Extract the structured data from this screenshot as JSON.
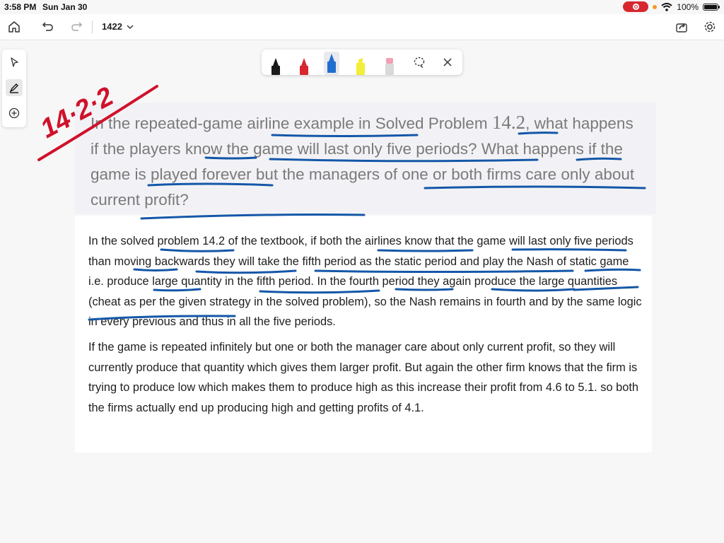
{
  "status_bar": {
    "time": "3:58 PM",
    "date": "Sun Jan 30",
    "battery": "100%"
  },
  "toolbar": {
    "document_title": "1422"
  },
  "icons": {
    "home": "home-icon",
    "undo": "undo-icon",
    "redo": "redo-icon",
    "share": "share-icon",
    "settings": "gear-icon",
    "select": "pointer-arrow-icon",
    "pen": "pen-icon",
    "add": "add-circle-icon",
    "lasso": "lasso-icon",
    "close": "close-icon"
  },
  "colors": {
    "ink_red": "#d0112b",
    "ink_blue": "#1457a8",
    "pen_black": "#1a1a1a",
    "pen_red": "#d8262f",
    "pen_blue": "#1f6fcf",
    "highlighter_yellow": "#f2ee3a",
    "eraser_pink": "#f2a0b4"
  },
  "pen_palette": {
    "tools": [
      "black-pen",
      "red-pen",
      "blue-pen",
      "yellow-highlighter",
      "eraser"
    ],
    "selected": "blue-pen"
  },
  "handwriting": {
    "annotation": "14·2·2"
  },
  "question": {
    "before": "In the repeated-game airline example in Solved Problem ",
    "number": "14.2",
    "after": ", what happens if the players know the game will last only five periods? What happens if the game is played forever but the managers of one or both firms care only about current profit?"
  },
  "answer": {
    "paragraph1": "In the solved problem 14.2 of the textbook, if both the airlines know that the game will last only five periods than moving backwards they will take the fifth period as the static period and play the Nash of static game i.e. produce large quantity in the fifth period. In the fourth period they again produce the large quantities (cheat as per the given strategy in the solved problem), so the Nash remains in fourth and by the same logic in every previous and thus in all the five periods.",
    "paragraph2": "If the game is repeated infinitely but one or both the manager care about only current profit, so they will currently produce that quantity which gives them larger profit. But again the other firm knows that the firm is trying to produce low which makes them to produce high as this increase their profit from 4.6 to 5.1. so both the firms actually end up producing high and getting profits of 4.1."
  }
}
